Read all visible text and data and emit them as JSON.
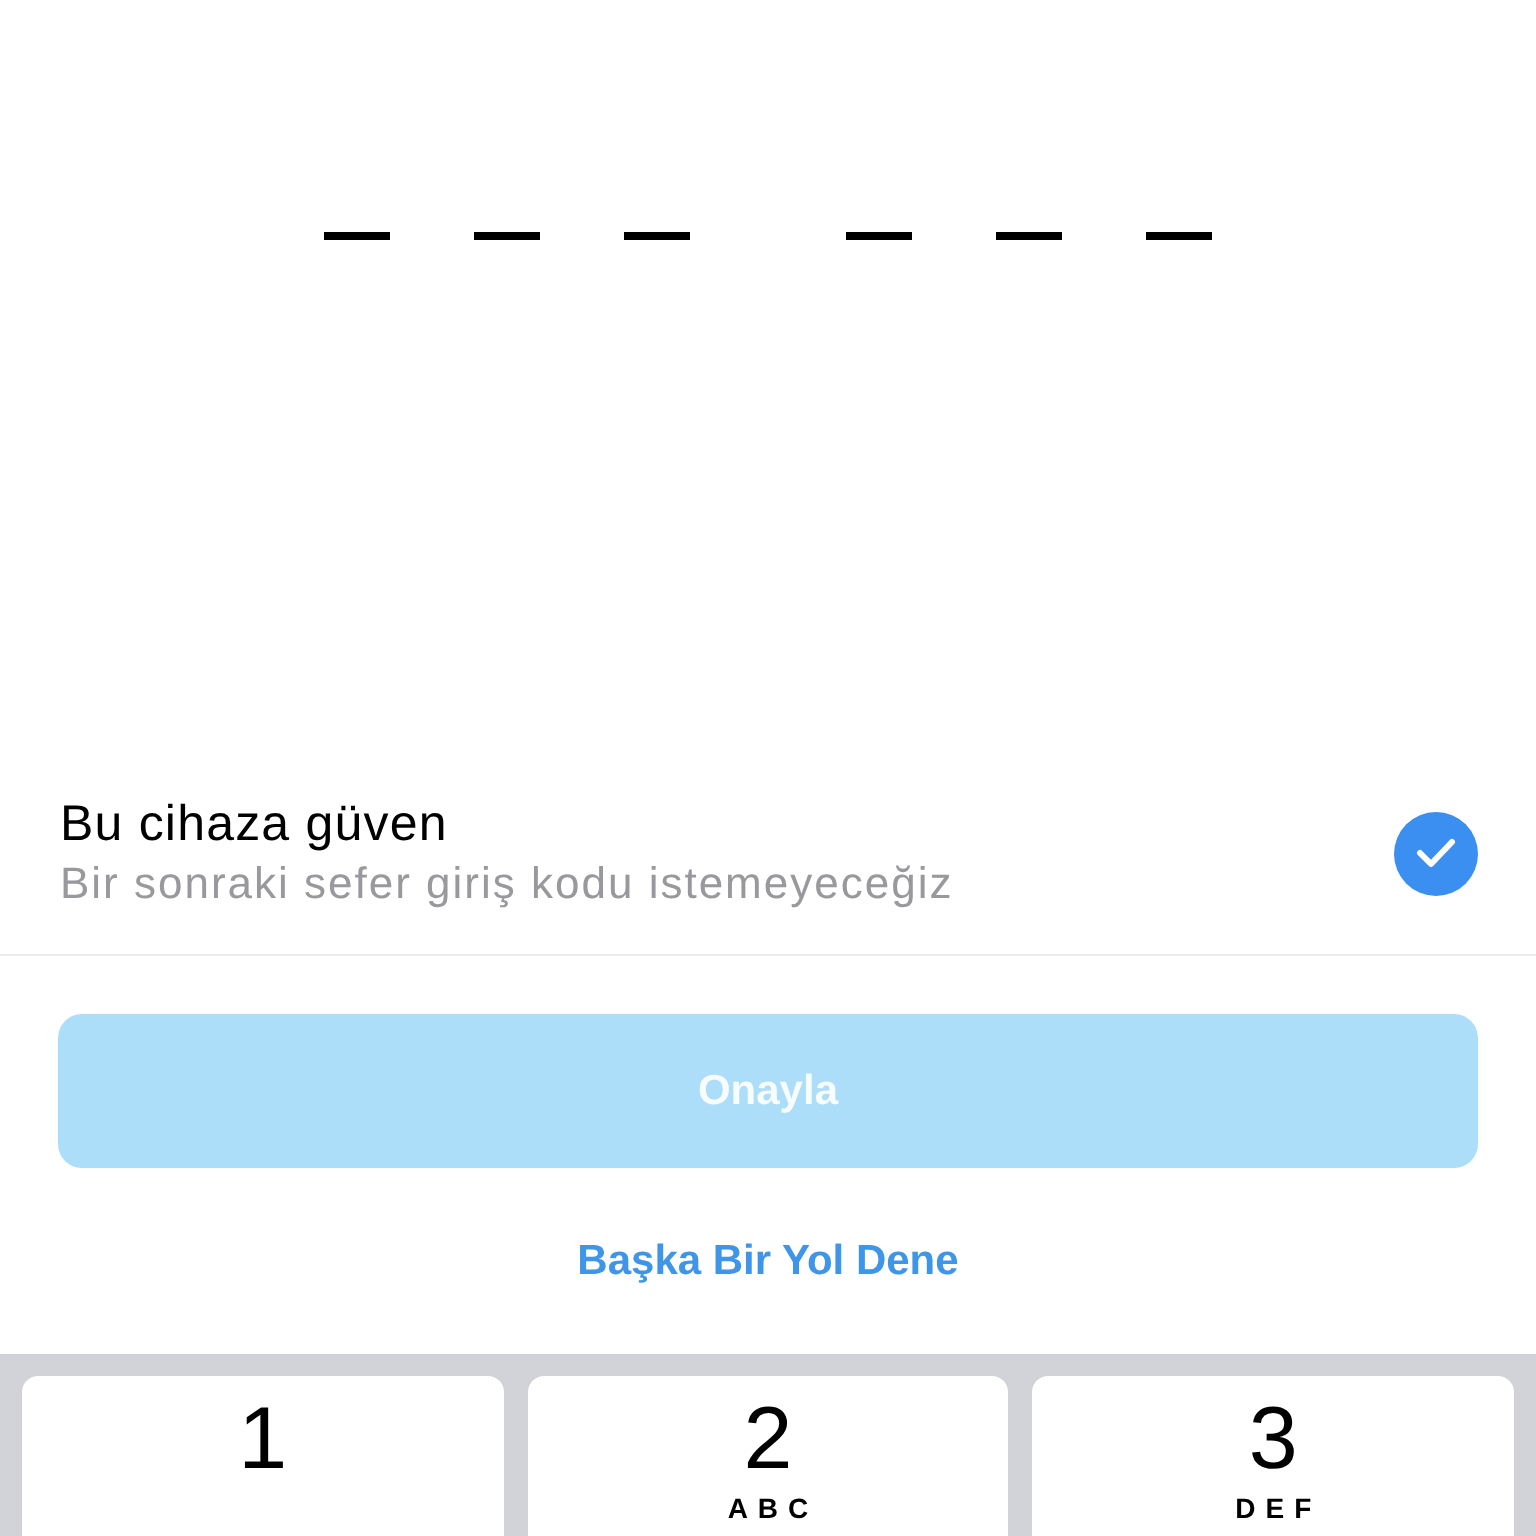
{
  "code": {
    "groups": [
      {
        "slots": [
          {
            "filled": false
          },
          {
            "filled": false
          },
          {
            "filled": false
          }
        ]
      },
      {
        "slots": [
          {
            "filled": false
          },
          {
            "filled": false
          },
          {
            "filled": false
          }
        ]
      }
    ]
  },
  "trust_device": {
    "title": "Bu cihaza güven",
    "subtitle": "Bir sonraki sefer giriş kodu istemeyeceğiz",
    "checked": true
  },
  "confirm_button": {
    "label": "Onayla",
    "disabled": true
  },
  "alternate_link": {
    "label": "Başka Bir Yol Dene"
  },
  "keypad": {
    "keys": [
      {
        "digit": "1"
      },
      {
        "digit": "2",
        "letters": "ABC"
      },
      {
        "digit": "3",
        "letters": "DEF"
      }
    ]
  }
}
